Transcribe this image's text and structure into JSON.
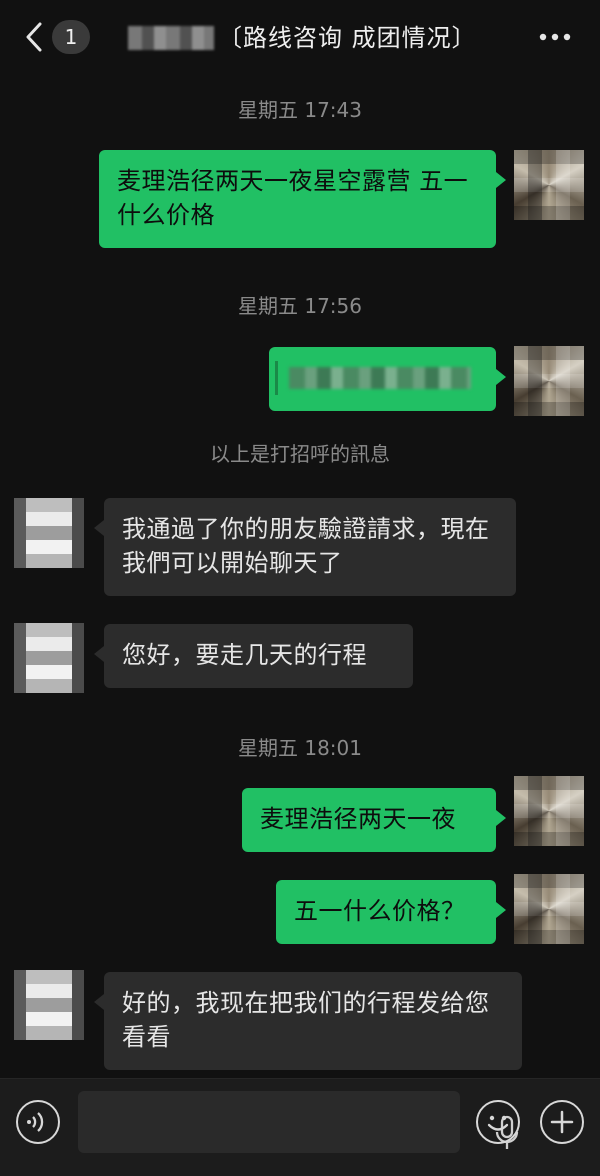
{
  "header": {
    "back_count": "1",
    "title": "〔路线咨询 成团情况〕",
    "icons": {
      "back": "chevron-left-icon",
      "more": "more-dots-icon"
    }
  },
  "messages": {
    "t1": "星期五 17:43",
    "m1": "麦理浩径两天一夜星空露营 五一什么价格",
    "t2": "星期五 17:56",
    "sys": "以上是打招呼的訊息",
    "m3": "我通過了你的朋友驗證請求，現在我們可以開始聊天了",
    "m4": "您好，要走几天的行程",
    "t3": "星期五 18:01",
    "m5": "麦理浩径两天一夜",
    "m6": "五一什么价格？",
    "m7": "好的，我现在把我们的行程发给您看看"
  },
  "colors": {
    "bubble_me": "#21c064",
    "bubble_other": "#2c2c2c",
    "bg": "#111111"
  },
  "input": {
    "icons": {
      "voice": "voice-mode-icon",
      "mic": "microphone-icon",
      "emoji": "emoji-icon",
      "plus": "plus-icon"
    }
  }
}
